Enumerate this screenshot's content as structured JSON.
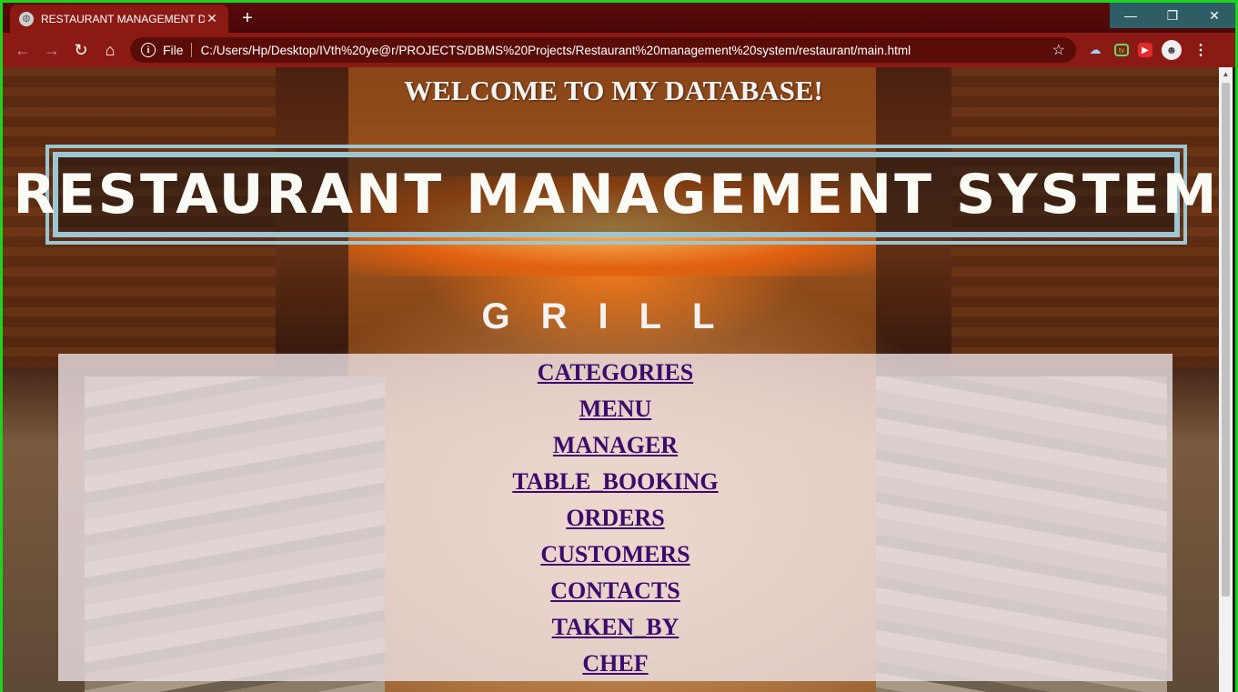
{
  "browser": {
    "tab_title": "RESTAURANT MANAGEMENT DA",
    "tab_close": "✕",
    "new_tab": "+",
    "window_buttons": {
      "minimize": "—",
      "restore": "❐",
      "close": "✕"
    },
    "nav": {
      "back": "←",
      "forward": "→",
      "reload": "↻",
      "home": "⌂"
    },
    "address": {
      "info_icon": "i",
      "scheme_label": "File",
      "url": "C:/Users/Hp/Desktop/IVth%20ye@r/PROJECTS/DBMS%20Projects/Restaurant%20management%20system/restaurant/main.html",
      "bookmark_icon": "☆"
    },
    "extensions": {
      "cloud": "☁",
      "tv": "tv",
      "red": "▶",
      "profile": "☻",
      "menu": "⋮"
    }
  },
  "page": {
    "welcome": "WELCOME TO MY DATABASE!",
    "title": "RESTAURANT MANAGEMENT SYSTEM",
    "background_sign": "GRILL",
    "menu": [
      {
        "label": "CATEGORIES"
      },
      {
        "label": "MENU"
      },
      {
        "label": "MANAGER"
      },
      {
        "label": "TABLE_BOOKING"
      },
      {
        "label": "ORDERS"
      },
      {
        "label": "CUSTOMERS"
      },
      {
        "label": "CONTACTS"
      },
      {
        "label": "TAKEN_BY"
      },
      {
        "label": "CHEF"
      }
    ],
    "colors": {
      "link": "#3b0b6e",
      "title_border": "#9cc6d2",
      "frame": "#1ed31e",
      "toolbar": "#8c1a14"
    }
  }
}
